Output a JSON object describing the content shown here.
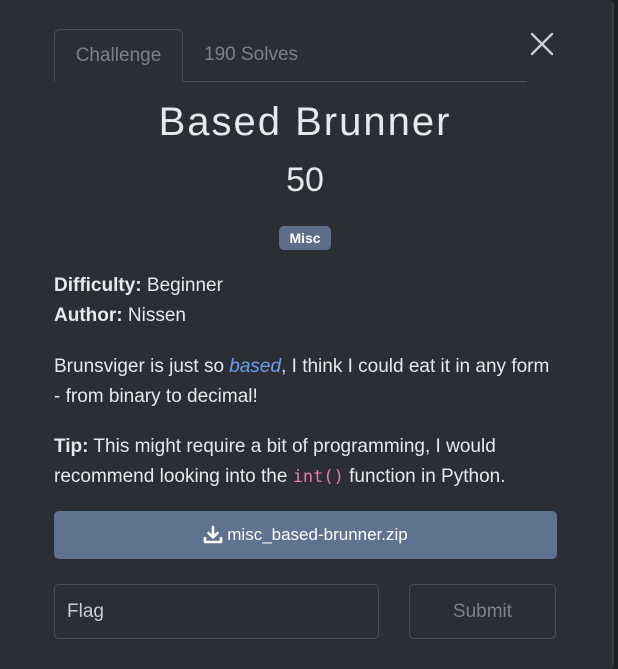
{
  "tabs": {
    "challenge_label": "Challenge",
    "solves_label": "190 Solves"
  },
  "challenge": {
    "name": "Based Brunner",
    "points": "50",
    "category": "Misc",
    "difficulty_label": "Difficulty:",
    "difficulty_value": "Beginner",
    "author_label": "Author:",
    "author_value": "Nissen",
    "description_pre": "Brunsviger is just so ",
    "description_em": "based",
    "description_post": ", I think I could eat it in any form - from binary to decimal!",
    "tip_label": "Tip:",
    "tip_pre": "This might require a bit of programming, I would recommend looking into the ",
    "tip_code": "int()",
    "tip_post": " function in Python."
  },
  "download": {
    "filename": "misc_based-brunner.zip",
    "icon": "download-icon"
  },
  "form": {
    "flag_placeholder": "Flag",
    "submit_label": "Submit"
  },
  "colors": {
    "modal_bg": "#2b2f35",
    "badge_bg": "#5d6e88",
    "download_bg": "#5f7290",
    "link": "#6a9ee8",
    "code": "#e87aa8"
  }
}
